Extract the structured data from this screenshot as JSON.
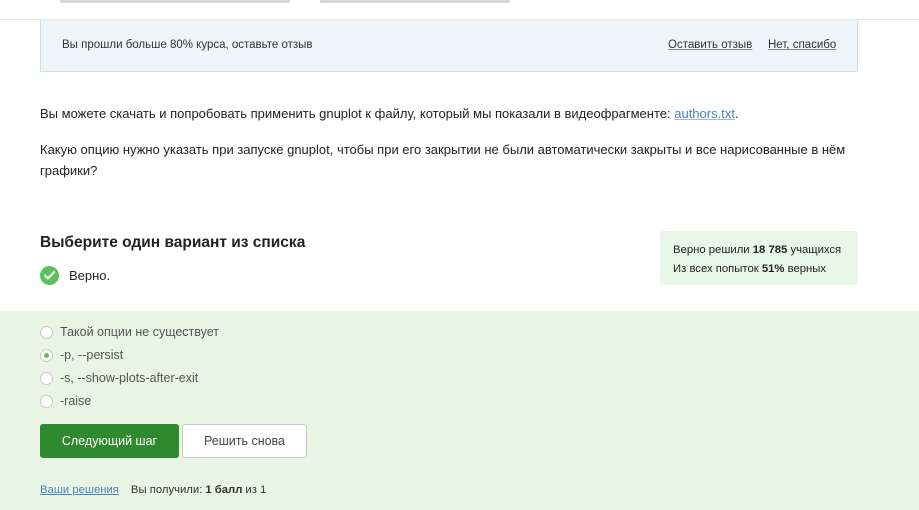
{
  "feedback": {
    "message": "Вы прошли больше 80% курса, оставьте отзыв",
    "leave_review": "Оставить отзыв",
    "no_thanks": "Нет, спасибо"
  },
  "step": {
    "para1_text": "Вы можете скачать и попробовать применить gnuplot к файлу, который мы показали в видеофрагменте: ",
    "para1_link": "authors.txt",
    "para1_end": ".",
    "question": "Какую опцию нужно указать при запуске gnuplot, чтобы при его закрытии не были автоматически закрыты и все нарисованные в нём графики?"
  },
  "quiz": {
    "heading": "Выберите один вариант из списка",
    "verdict": "Верно.",
    "options": [
      {
        "label": "Такой опции не существует",
        "selected": false
      },
      {
        "label": "-p, --persist",
        "selected": true
      },
      {
        "label": "-s, --show-plots-after-exit",
        "selected": false
      },
      {
        "label": "-raise",
        "selected": false
      }
    ],
    "next_button": "Следующий шаг",
    "retry_button": "Решить снова"
  },
  "stats": {
    "solved_prefix": "Верно решили ",
    "solved_count": "18 785",
    "solved_suffix": " учащихся",
    "attempts_prefix": "Из всех попыток ",
    "attempts_percent": "51%",
    "attempts_suffix": " верных"
  },
  "footer": {
    "solutions_link": "Ваши решения",
    "score_prefix": "Вы получили: ",
    "score_value": "1 балл",
    "score_suffix": "из 1"
  },
  "colors": {
    "primary_green": "#2f8a2d",
    "check_green": "#5bc25b",
    "answer_bg": "#e8f5e4",
    "link_blue": "#4a7fc1"
  }
}
